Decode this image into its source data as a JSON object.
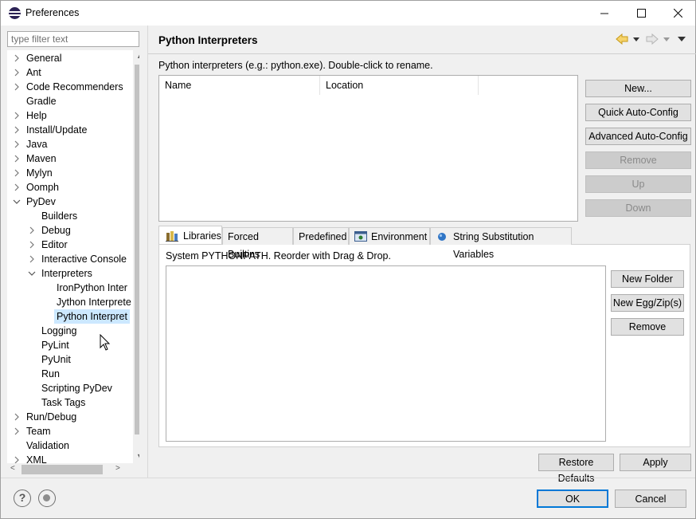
{
  "window": {
    "title": "Preferences",
    "controls": {
      "minimize": "minimize-icon",
      "maximize": "maximize-icon",
      "close": "close-icon"
    }
  },
  "filter": {
    "placeholder": "type filter text"
  },
  "tree": {
    "items": [
      {
        "label": "General",
        "level": 0,
        "expander": "collapsed"
      },
      {
        "label": "Ant",
        "level": 0,
        "expander": "collapsed"
      },
      {
        "label": "Code Recommenders",
        "level": 0,
        "expander": "collapsed"
      },
      {
        "label": "Gradle",
        "level": 0,
        "expander": "none"
      },
      {
        "label": "Help",
        "level": 0,
        "expander": "collapsed"
      },
      {
        "label": "Install/Update",
        "level": 0,
        "expander": "collapsed"
      },
      {
        "label": "Java",
        "level": 0,
        "expander": "collapsed"
      },
      {
        "label": "Maven",
        "level": 0,
        "expander": "collapsed"
      },
      {
        "label": "Mylyn",
        "level": 0,
        "expander": "collapsed"
      },
      {
        "label": "Oomph",
        "level": 0,
        "expander": "collapsed"
      },
      {
        "label": "PyDev",
        "level": 0,
        "expander": "expanded"
      },
      {
        "label": "Builders",
        "level": 1,
        "expander": "none"
      },
      {
        "label": "Debug",
        "level": 1,
        "expander": "collapsed"
      },
      {
        "label": "Editor",
        "level": 1,
        "expander": "collapsed"
      },
      {
        "label": "Interactive Console",
        "level": 1,
        "expander": "collapsed"
      },
      {
        "label": "Interpreters",
        "level": 1,
        "expander": "expanded"
      },
      {
        "label": "IronPython Inter",
        "level": 2,
        "expander": "none"
      },
      {
        "label": "Jython Interprete",
        "level": 2,
        "expander": "none"
      },
      {
        "label": "Python Interpret",
        "level": 2,
        "expander": "none",
        "selected": true
      },
      {
        "label": "Logging",
        "level": 1,
        "expander": "none"
      },
      {
        "label": "PyLint",
        "level": 1,
        "expander": "none"
      },
      {
        "label": "PyUnit",
        "level": 1,
        "expander": "none"
      },
      {
        "label": "Run",
        "level": 1,
        "expander": "none"
      },
      {
        "label": "Scripting PyDev",
        "level": 1,
        "expander": "none"
      },
      {
        "label": "Task Tags",
        "level": 1,
        "expander": "none"
      },
      {
        "label": "Run/Debug",
        "level": 0,
        "expander": "collapsed"
      },
      {
        "label": "Team",
        "level": 0,
        "expander": "collapsed"
      },
      {
        "label": "Validation",
        "level": 0,
        "expander": "none"
      },
      {
        "label": "XML",
        "level": 0,
        "expander": "collapsed"
      }
    ]
  },
  "page": {
    "title": "Python Interpreters",
    "description": "Python interpreters (e.g.: python.exe).   Double-click to rename.",
    "table_columns": [
      "Name",
      "Location"
    ],
    "buttons": {
      "new": "New...",
      "quick_auto": "Quick Auto-Config",
      "advanced_auto": "Advanced Auto-Config",
      "remove": "Remove",
      "up": "Up",
      "down": "Down"
    },
    "tabs": [
      {
        "label": "Libraries",
        "icon": "libraries-icon",
        "active": true
      },
      {
        "label": "Forced Builtins"
      },
      {
        "label": "Predefined"
      },
      {
        "label": "Environment",
        "icon": "environment-icon"
      },
      {
        "label": "String Substitution Variables",
        "icon": "variables-icon"
      }
    ],
    "libraries": {
      "description": "System PYTHONPATH.   Reorder with Drag & Drop.",
      "buttons": {
        "new_folder": "New Folder",
        "new_egg": "New Egg/Zip(s)",
        "remove": "Remove"
      }
    },
    "restore_defaults": "Restore Defaults",
    "apply": "Apply"
  },
  "footer": {
    "ok": "OK",
    "cancel": "Cancel"
  },
  "colors": {
    "selection": "#cce8ff",
    "accent": "#0078d7"
  }
}
